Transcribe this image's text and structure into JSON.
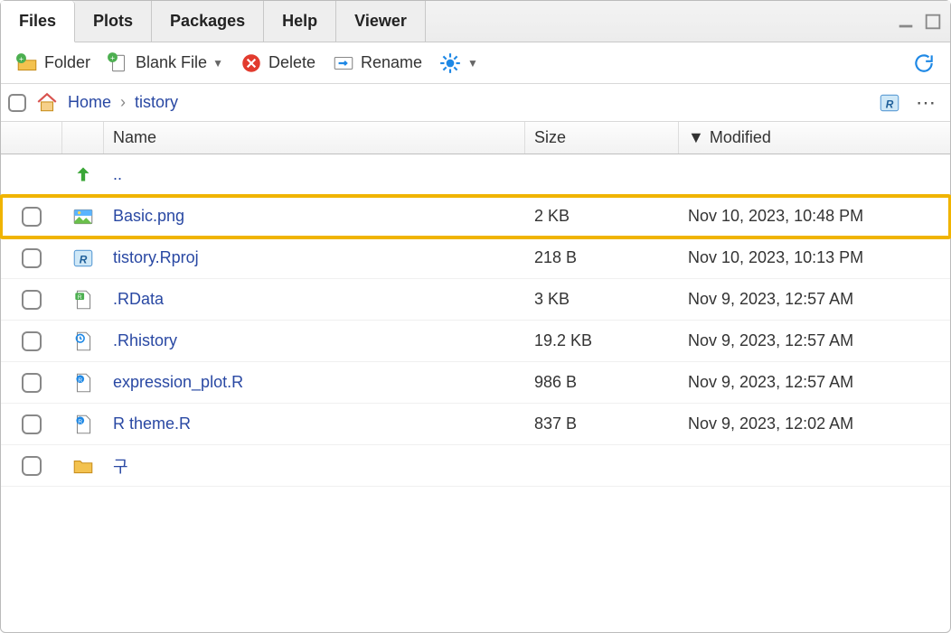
{
  "tabs": {
    "items": [
      {
        "label": "Files",
        "active": true
      },
      {
        "label": "Plots",
        "active": false
      },
      {
        "label": "Packages",
        "active": false
      },
      {
        "label": "Help",
        "active": false
      },
      {
        "label": "Viewer",
        "active": false
      }
    ]
  },
  "toolbar": {
    "folder_label": "Folder",
    "blank_file_label": "Blank File",
    "delete_label": "Delete",
    "rename_label": "Rename"
  },
  "breadcrumb": {
    "home_label": "Home",
    "current": "tistory"
  },
  "columns": {
    "name": "Name",
    "size": "Size",
    "modified": "Modified"
  },
  "parent_label": "..",
  "files": [
    {
      "name": "Basic.png",
      "size": "2 KB",
      "modified": "Nov 10, 2023, 10:48 PM",
      "icon": "image",
      "highlight": true
    },
    {
      "name": "tistory.Rproj",
      "size": "218 B",
      "modified": "Nov 10, 2023, 10:13 PM",
      "icon": "rproj"
    },
    {
      "name": ".RData",
      "size": "3 KB",
      "modified": "Nov 9, 2023, 12:57 AM",
      "icon": "rdata"
    },
    {
      "name": ".Rhistory",
      "size": "19.2 KB",
      "modified": "Nov 9, 2023, 12:57 AM",
      "icon": "history"
    },
    {
      "name": "expression_plot.R",
      "size": "986 B",
      "modified": "Nov 9, 2023, 12:57 AM",
      "icon": "rfile"
    },
    {
      "name": "R theme.R",
      "size": "837 B",
      "modified": "Nov 9, 2023, 12:02 AM",
      "icon": "rfile"
    },
    {
      "name": "구",
      "size": "",
      "modified": "",
      "icon": "folder"
    }
  ]
}
